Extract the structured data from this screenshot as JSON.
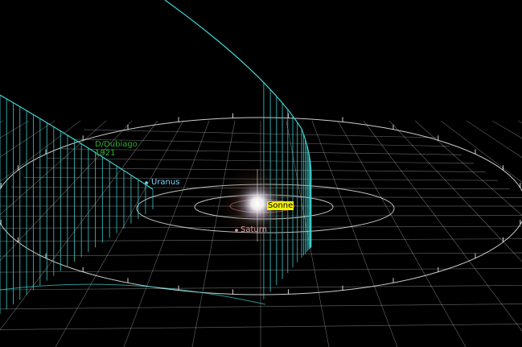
{
  "scene": {
    "background": "#000000",
    "grid_color": "#ffffff",
    "orbit_color": "#ffffff",
    "comet_orbit_color": "#3fd2d2"
  },
  "labels": {
    "comet_name": "D/Dubiago",
    "comet_year": "1921",
    "uranus": "Uranus",
    "saturn": "Saturn",
    "sun": "Sonne"
  },
  "colors": {
    "comet_label": "#2fae2f",
    "uranus_label": "#7fd6ff",
    "saturn_label": "#e89aa3",
    "sun_label_bg": "#f4f000"
  }
}
